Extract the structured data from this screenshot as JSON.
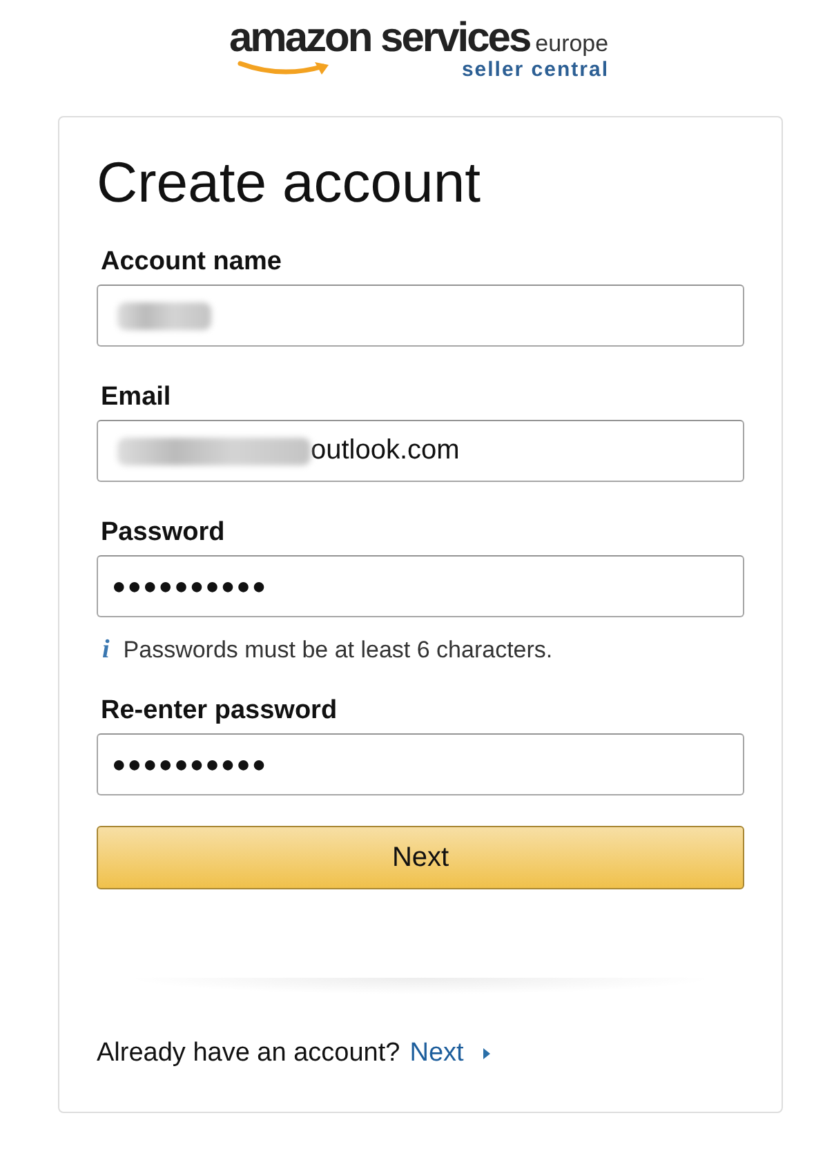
{
  "logo": {
    "brand": "amazon services",
    "region": "europe",
    "product": "seller central"
  },
  "title": "Create account",
  "fields": [
    {
      "label": "Account name",
      "kind": "text",
      "redacted": true
    },
    {
      "label": "Email",
      "kind": "text",
      "value": "outlook.com",
      "redacted": true
    },
    {
      "label": "Password",
      "kind": "password",
      "value": "●●●●●●●●●●",
      "hint": "Passwords must be at least 6 characters.",
      "hint_icon": "i"
    },
    {
      "label": "Re-enter password",
      "kind": "password",
      "value": "●●●●●●●●●●"
    }
  ],
  "button": "Next",
  "footer": {
    "text": "Already have an account?",
    "link": "Next"
  }
}
